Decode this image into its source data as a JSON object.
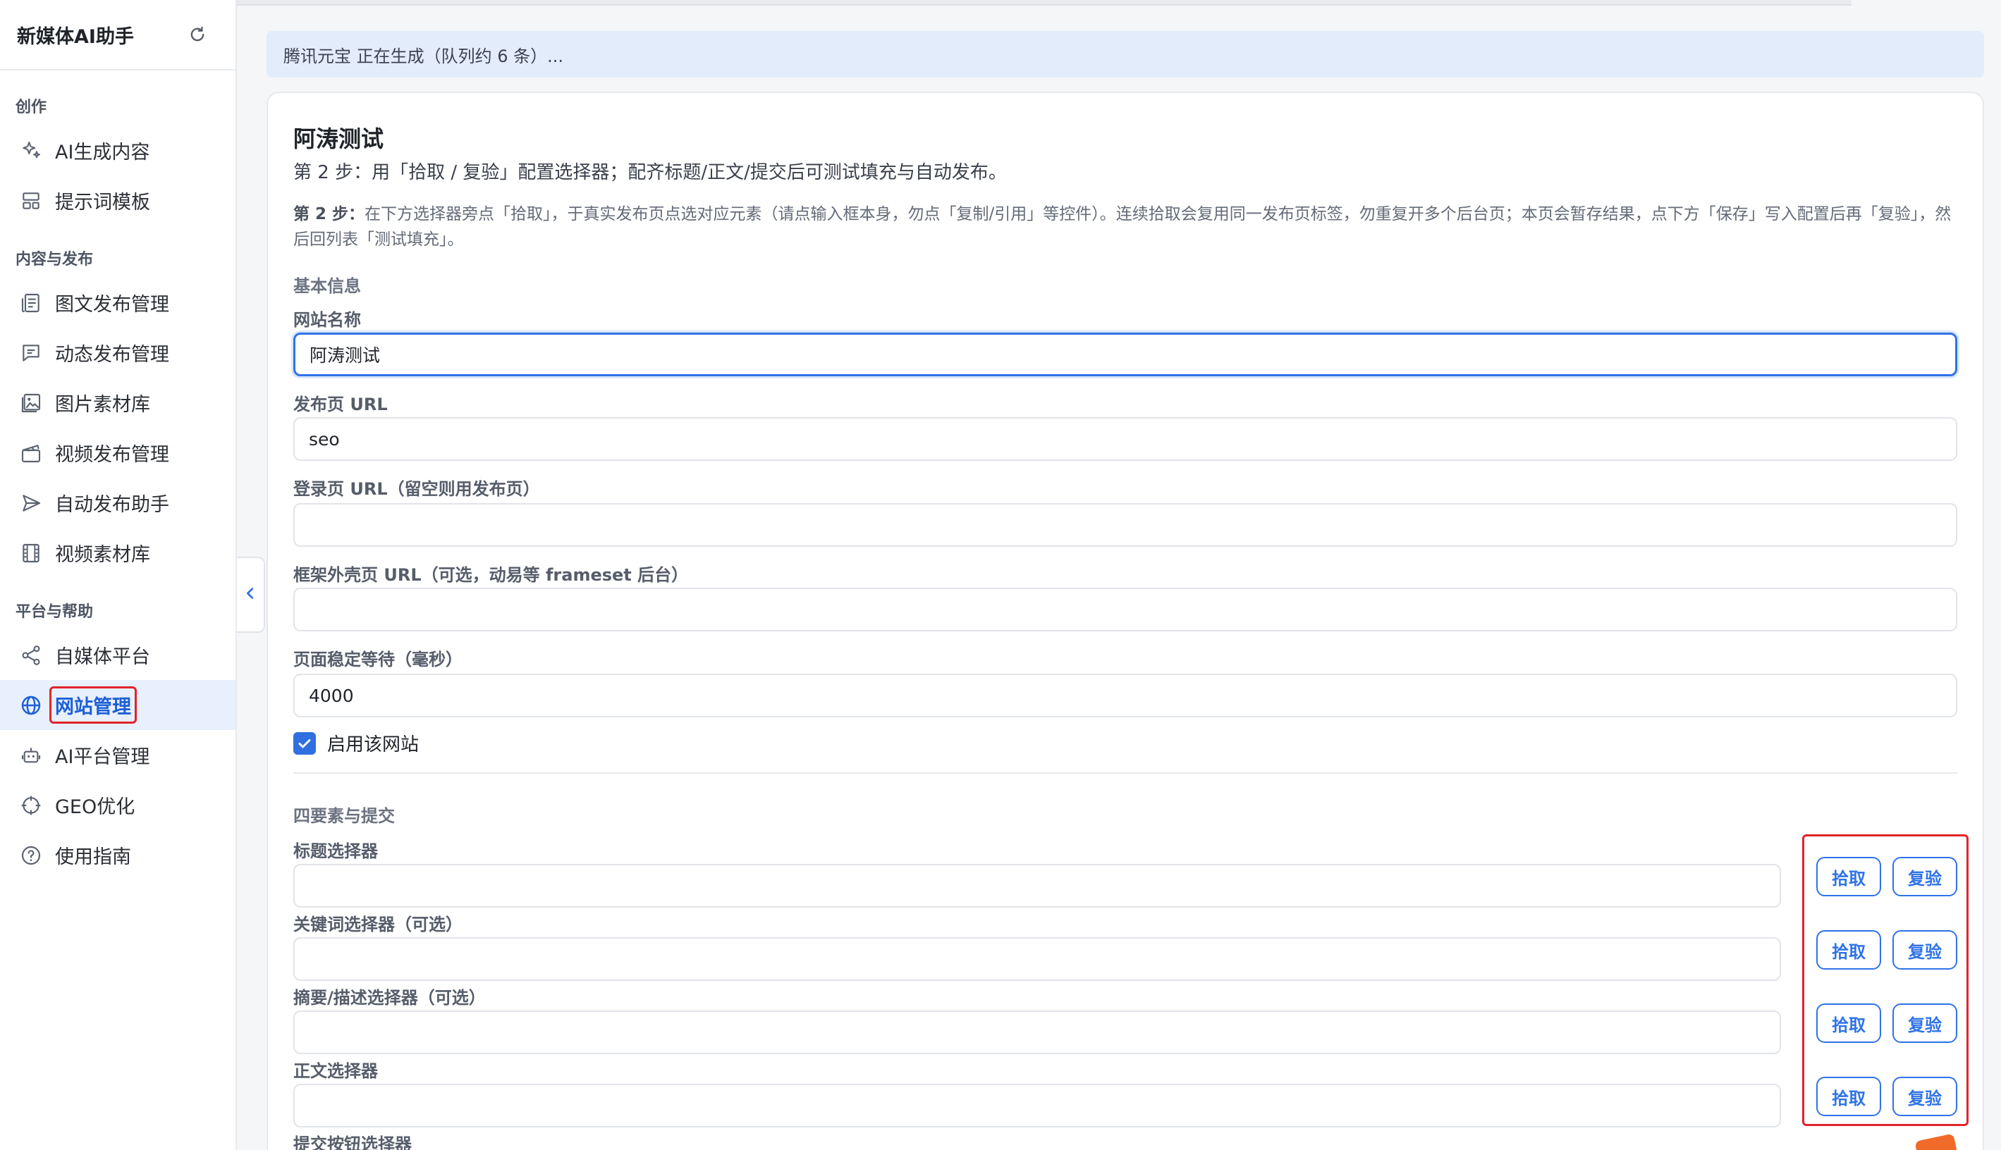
{
  "app": {
    "title": "新媒体AI助手"
  },
  "sidebar": {
    "groups": [
      {
        "title": "创作",
        "items": [
          {
            "label": "AI生成内容",
            "icon": "sparkle-icon"
          },
          {
            "label": "提示词模板",
            "icon": "template-icon"
          }
        ]
      },
      {
        "title": "内容与发布",
        "items": [
          {
            "label": "图文发布管理",
            "icon": "article-icon"
          },
          {
            "label": "动态发布管理",
            "icon": "message-icon"
          },
          {
            "label": "图片素材库",
            "icon": "image-icon"
          },
          {
            "label": "视频发布管理",
            "icon": "clapper-icon"
          },
          {
            "label": "自动发布助手",
            "icon": "send-icon"
          },
          {
            "label": "视频素材库",
            "icon": "film-icon"
          }
        ]
      },
      {
        "title": "平台与帮助",
        "items": [
          {
            "label": "自媒体平台",
            "icon": "share-icon"
          },
          {
            "label": "网站管理",
            "icon": "globe-icon",
            "active": true
          },
          {
            "label": "AI平台管理",
            "icon": "robot-icon"
          },
          {
            "label": "GEO优化",
            "icon": "target-icon"
          },
          {
            "label": "使用指南",
            "icon": "help-icon"
          }
        ]
      }
    ]
  },
  "banner": {
    "text": "腾讯元宝 正在生成（队列约 6 条）..."
  },
  "form": {
    "title": "阿涛测试",
    "subtitle": "第 2 步：用「拾取 / 复验」配置选择器；配齐标题/正文/提交后可测试填充与自动发布。",
    "desc_strong": "第 2 步：",
    "desc_body": "在下方选择器旁点「拾取」，于真实发布页点选对应元素（请点输入框本身，勿点「复制/引用」等控件）。连续拾取会复用同一发布页标签，勿重复开多个后台页；本页会暂存结果，点下方「保存」写入配置后再「复验」，然后回列表「测试填充」。",
    "basic_section": "基本信息",
    "fields": {
      "site_name": {
        "label": "网站名称",
        "value": "阿涛测试"
      },
      "publish_url": {
        "label": "发布页 URL",
        "value": "seo"
      },
      "login_url": {
        "label": "登录页 URL（留空则用发布页）",
        "value": ""
      },
      "frame_url": {
        "label": "框架外壳页 URL（可选，动易等 frameset 后台）",
        "value": ""
      },
      "wait_ms": {
        "label": "页面稳定等待（毫秒）",
        "value": "4000"
      }
    },
    "enable": {
      "label": "启用该网站",
      "checked": true
    },
    "selectors_section": "四要素与提交",
    "selectors": [
      {
        "label": "标题选择器",
        "value": ""
      },
      {
        "label": "关键词选择器（可选）",
        "value": ""
      },
      {
        "label": "摘要/描述选择器（可选）",
        "value": ""
      },
      {
        "label": "正文选择器",
        "value": ""
      },
      {
        "label": "提交按钮选择器",
        "value": ""
      }
    ],
    "pick_label": "拾取",
    "verify_label": "复验"
  },
  "colors": {
    "accent": "#2f73e8",
    "highlight_box": "#e0242b",
    "active_bg": "#e8f0fd",
    "banner_bg": "#e3ecfb"
  }
}
